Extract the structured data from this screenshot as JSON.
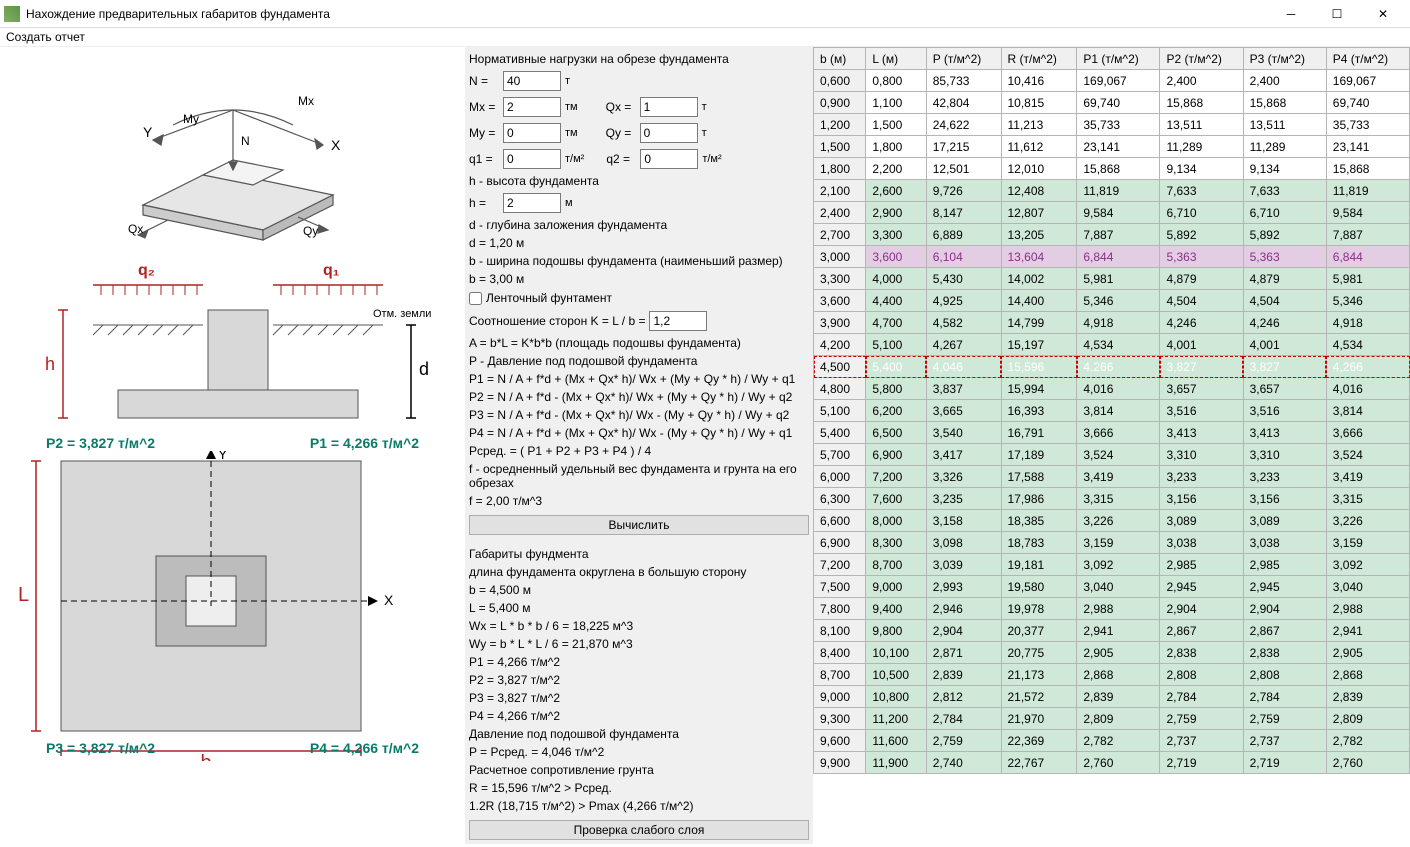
{
  "window": {
    "title": "Нахождение предварительных габаритов фундамента"
  },
  "menu": {
    "report": "Создать отчет"
  },
  "loads": {
    "heading": "Нормативные нагрузки на обрезе фундамента",
    "N_label": "N =",
    "N": "40",
    "N_unit": "т",
    "Mx_label": "Mx =",
    "Mx": "2",
    "Mx_unit": "тм",
    "Qx_label": "Qx =",
    "Qx": "1",
    "Qx_unit": "т",
    "My_label": "My =",
    "My": "0",
    "My_unit": "тм",
    "Qy_label": "Qy =",
    "Qy": "0",
    "Qy_unit": "т",
    "q1_label": "q1 =",
    "q1": "0",
    "q1_unit": "т/м²",
    "q2_label": "q2 =",
    "q2": "0",
    "q2_unit": "т/м²"
  },
  "geom": {
    "h_desc": "h - высота фундамента",
    "h_label": "h =",
    "h": "2",
    "h_unit": "м",
    "d_desc": "d - глубина заложения фундамента",
    "d_val": "d = 1,20 м",
    "b_desc": "b - ширина подошвы фундамента (наименьший размер)",
    "b_val": "b = 3,00 м",
    "strip_cb": "Ленточный фунтамент",
    "K_label": "Соотношение сторон K = L / b =",
    "K": "1,2",
    "A_formula": "A = b*L = K*b*b      (площадь подошвы фундамента)",
    "P_desc": "P - Давление под подошвой фундамента",
    "P1f": "P1 = N / A + f*d + (Mx + Qx* h)/ Wx + (My + Qy * h) / Wy + q1",
    "P2f": "P2 = N / A + f*d - (Mx + Qx* h)/ Wx + (My + Qy * h) / Wy + q2",
    "P3f": "P3 = N / A + f*d - (Mx + Qx* h)/ Wx  - (My + Qy * h) / Wy + q2",
    "P4f": "P4 = N / A + f*d + (Mx + Qx* h)/ Wx  - (My + Qy * h) / Wy + q1",
    "Pavg": "Pсред. = ( P1 + P2 + P3 + P4 ) / 4",
    "f_desc": "f - осредненный удельный вес фундамента и грунта на его обрезах",
    "f_val": "f = 2,00 т/м^3",
    "calc_btn": "Вычислить"
  },
  "result": {
    "heading": "Габариты фундмента",
    "round": "длина фундамента округлена в большую сторону",
    "bv": "b = 4,500 м",
    "Lv": "L = 5,400 м",
    "Wx": "Wx = L * b * b / 6  = 18,225 м^3",
    "Wy": "Wy  = b * L * L / 6  = 21,870 м^3",
    "P1": "P1 = 4,266 т/м^2",
    "P2": "P2 = 3,827 т/м^2",
    "P3": "P3 = 3,827 т/м^2",
    "P4": "P4 = 4,266 т/м^2",
    "Pd": "Давление под подошвой фундамента",
    "Pv": "P = Pсред. = 4,046 т/м^2",
    "Rd": "Расчетное сопротивление грунта",
    "Rv": "R = 15,596 т/м^2  >  Pсред.",
    "Rmax": "1.2R (18,715 т/м^2)  >  Pmax (4,266 т/м^2)",
    "weak_btn": "Проверка слабого слоя"
  },
  "section": {
    "q1": "q₁",
    "q2": "q₂",
    "h": "h",
    "d": "d",
    "ground": "Отм. земли"
  },
  "plan": {
    "P1": "P1 = 4,266 т/м^2",
    "P2": "P2 = 3,827 т/м^2",
    "P3": "P3 = 3,827 т/м^2",
    "P4": "P4 = 4,266 т/м^2",
    "L": "L",
    "b": "b",
    "X": "X",
    "Y": "Y"
  },
  "iso": {
    "Mx": "Mx",
    "My": "My",
    "N": "N",
    "Qx": "Qx",
    "Qy": "Qy",
    "X": "X",
    "Y": "Y"
  },
  "table": {
    "headers": [
      "b (м)",
      "L (м)",
      "P (т/м^2)",
      "R (т/м^2)",
      "P1 (т/м^2)",
      "P2 (т/м^2)",
      "P3 (т/м^2)",
      "P4 (т/м^2)"
    ],
    "rows": [
      {
        "c": "white",
        "v": [
          "0,600",
          "0,800",
          "85,733",
          "10,416",
          "169,067",
          "2,400",
          "2,400",
          "169,067"
        ]
      },
      {
        "c": "white",
        "v": [
          "0,900",
          "1,100",
          "42,804",
          "10,815",
          "69,740",
          "15,868",
          "15,868",
          "69,740"
        ]
      },
      {
        "c": "white",
        "v": [
          "1,200",
          "1,500",
          "24,622",
          "11,213",
          "35,733",
          "13,511",
          "13,511",
          "35,733"
        ]
      },
      {
        "c": "white",
        "v": [
          "1,500",
          "1,800",
          "17,215",
          "11,612",
          "23,141",
          "11,289",
          "11,289",
          "23,141"
        ]
      },
      {
        "c": "white",
        "v": [
          "1,800",
          "2,200",
          "12,501",
          "12,010",
          "15,868",
          "9,134",
          "9,134",
          "15,868"
        ]
      },
      {
        "c": "green",
        "v": [
          "2,100",
          "2,600",
          "9,726",
          "12,408",
          "11,819",
          "7,633",
          "7,633",
          "11,819"
        ]
      },
      {
        "c": "green",
        "v": [
          "2,400",
          "2,900",
          "8,147",
          "12,807",
          "9,584",
          "6,710",
          "6,710",
          "9,584"
        ]
      },
      {
        "c": "green",
        "v": [
          "2,700",
          "3,300",
          "6,889",
          "13,205",
          "7,887",
          "5,892",
          "5,892",
          "7,887"
        ]
      },
      {
        "c": "purple",
        "v": [
          "3,000",
          "3,600",
          "6,104",
          "13,604",
          "6,844",
          "5,363",
          "5,363",
          "6,844"
        ]
      },
      {
        "c": "green",
        "v": [
          "3,300",
          "4,000",
          "5,430",
          "14,002",
          "5,981",
          "4,879",
          "4,879",
          "5,981"
        ]
      },
      {
        "c": "green",
        "v": [
          "3,600",
          "4,400",
          "4,925",
          "14,400",
          "5,346",
          "4,504",
          "4,504",
          "5,346"
        ]
      },
      {
        "c": "green",
        "v": [
          "3,900",
          "4,700",
          "4,582",
          "14,799",
          "4,918",
          "4,246",
          "4,246",
          "4,918"
        ]
      },
      {
        "c": "green",
        "v": [
          "4,200",
          "5,100",
          "4,267",
          "15,197",
          "4,534",
          "4,001",
          "4,001",
          "4,534"
        ]
      },
      {
        "c": "sel",
        "v": [
          "4,500",
          "5,400",
          "4,046",
          "15,596",
          "4,266",
          "3,827",
          "3,827",
          "4,266"
        ]
      },
      {
        "c": "green",
        "v": [
          "4,800",
          "5,800",
          "3,837",
          "15,994",
          "4,016",
          "3,657",
          "3,657",
          "4,016"
        ]
      },
      {
        "c": "green",
        "v": [
          "5,100",
          "6,200",
          "3,665",
          "16,393",
          "3,814",
          "3,516",
          "3,516",
          "3,814"
        ]
      },
      {
        "c": "green",
        "v": [
          "5,400",
          "6,500",
          "3,540",
          "16,791",
          "3,666",
          "3,413",
          "3,413",
          "3,666"
        ]
      },
      {
        "c": "green",
        "v": [
          "5,700",
          "6,900",
          "3,417",
          "17,189",
          "3,524",
          "3,310",
          "3,310",
          "3,524"
        ]
      },
      {
        "c": "green",
        "v": [
          "6,000",
          "7,200",
          "3,326",
          "17,588",
          "3,419",
          "3,233",
          "3,233",
          "3,419"
        ]
      },
      {
        "c": "green",
        "v": [
          "6,300",
          "7,600",
          "3,235",
          "17,986",
          "3,315",
          "3,156",
          "3,156",
          "3,315"
        ]
      },
      {
        "c": "green",
        "v": [
          "6,600",
          "8,000",
          "3,158",
          "18,385",
          "3,226",
          "3,089",
          "3,089",
          "3,226"
        ]
      },
      {
        "c": "green",
        "v": [
          "6,900",
          "8,300",
          "3,098",
          "18,783",
          "3,159",
          "3,038",
          "3,038",
          "3,159"
        ]
      },
      {
        "c": "green",
        "v": [
          "7,200",
          "8,700",
          "3,039",
          "19,181",
          "3,092",
          "2,985",
          "2,985",
          "3,092"
        ]
      },
      {
        "c": "green",
        "v": [
          "7,500",
          "9,000",
          "2,993",
          "19,580",
          "3,040",
          "2,945",
          "2,945",
          "3,040"
        ]
      },
      {
        "c": "green",
        "v": [
          "7,800",
          "9,400",
          "2,946",
          "19,978",
          "2,988",
          "2,904",
          "2,904",
          "2,988"
        ]
      },
      {
        "c": "green",
        "v": [
          "8,100",
          "9,800",
          "2,904",
          "20,377",
          "2,941",
          "2,867",
          "2,867",
          "2,941"
        ]
      },
      {
        "c": "green",
        "v": [
          "8,400",
          "10,100",
          "2,871",
          "20,775",
          "2,905",
          "2,838",
          "2,838",
          "2,905"
        ]
      },
      {
        "c": "green",
        "v": [
          "8,700",
          "10,500",
          "2,839",
          "21,173",
          "2,868",
          "2,808",
          "2,808",
          "2,868"
        ]
      },
      {
        "c": "green",
        "v": [
          "9,000",
          "10,800",
          "2,812",
          "21,572",
          "2,839",
          "2,784",
          "2,784",
          "2,839"
        ]
      },
      {
        "c": "green",
        "v": [
          "9,300",
          "11,200",
          "2,784",
          "21,970",
          "2,809",
          "2,759",
          "2,759",
          "2,809"
        ]
      },
      {
        "c": "green",
        "v": [
          "9,600",
          "11,600",
          "2,759",
          "22,369",
          "2,782",
          "2,737",
          "2,737",
          "2,782"
        ]
      },
      {
        "c": "green",
        "v": [
          "9,900",
          "11,900",
          "2,740",
          "22,767",
          "2,760",
          "2,719",
          "2,719",
          "2,760"
        ]
      }
    ]
  }
}
